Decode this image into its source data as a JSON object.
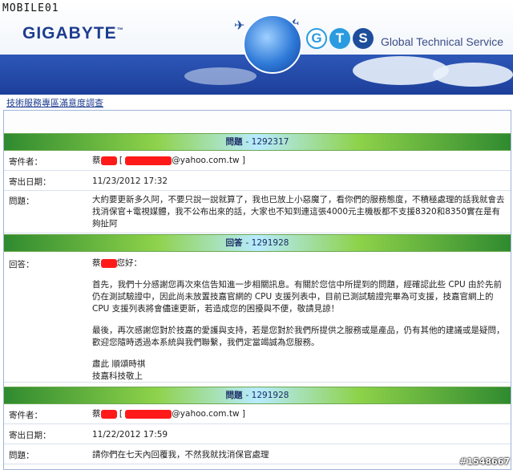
{
  "watermark_top": "MOBILE01",
  "logo": "GIGABYTE",
  "logo_tm": "™",
  "gts_letters": [
    "G",
    "T",
    "S"
  ],
  "gts_title": "Global Technical Service",
  "breadcrumb": "技術服務專區滿意度調查",
  "sections": [
    {
      "header_label": "問題",
      "header_num": "- 1292317",
      "rows": [
        {
          "label": "寄件者：",
          "name": "蔡",
          "email": "@yahoo.com.tw ]",
          "bracket_open": "["
        },
        {
          "label": "寄出日期：",
          "value": "11/23/2012 17:32"
        },
        {
          "label": "問題：",
          "value": "大約要更新多久阿，不要只說一說就算了，我也已放上小惡魔了，看你們的服務態度，不積極處理的話我就會去找消保官+電視媒體，我不公布出來的話，大家也不知到連這張4000元主機板都不支援8320和8350實在是有夠扯阿"
        }
      ]
    },
    {
      "header_label": "回答",
      "header_num": "- 1291928",
      "reply_label": "回答：",
      "greeting_name": "蔡",
      "greeting_suffix": "您好：",
      "paragraphs": [
        "首先，我們十分感謝您再次來信告知進一步相關訊息。有關於您信中所提到的問題，經確認此些 CPU 由於先前仍在測試驗證中，因此尚未放置技嘉官網的 CPU 支援列表中，目前已測試驗證完畢為可支援，技嘉官網上的 CPU 支援列表將會儘速更新，若造成您的困擾與不便，敬請見諒！",
        "最後，再次感謝您對於技嘉的愛護與支持，若是您對於我們所提供之服務或是產品，仍有其他的建議或是疑問，歡迎您隨時透過本系統與我們聯繫，我們定當竭誠為您服務。"
      ],
      "closing": [
        "肅此 順頌時祺",
        "技嘉科技敬上"
      ]
    },
    {
      "header_label": "問題",
      "header_num": "- 1291928",
      "rows": [
        {
          "label": "寄件者：",
          "name": "蔡",
          "email": "@yahoo.com.tw ]",
          "bracket_open": "["
        },
        {
          "label": "寄出日期：",
          "value": "11/22/2012 17:59"
        },
        {
          "label": "問題：",
          "value": "請你們在七天內回覆我，不然我就找消保官處理"
        }
      ]
    }
  ],
  "watermark_bottom": "#1548667"
}
